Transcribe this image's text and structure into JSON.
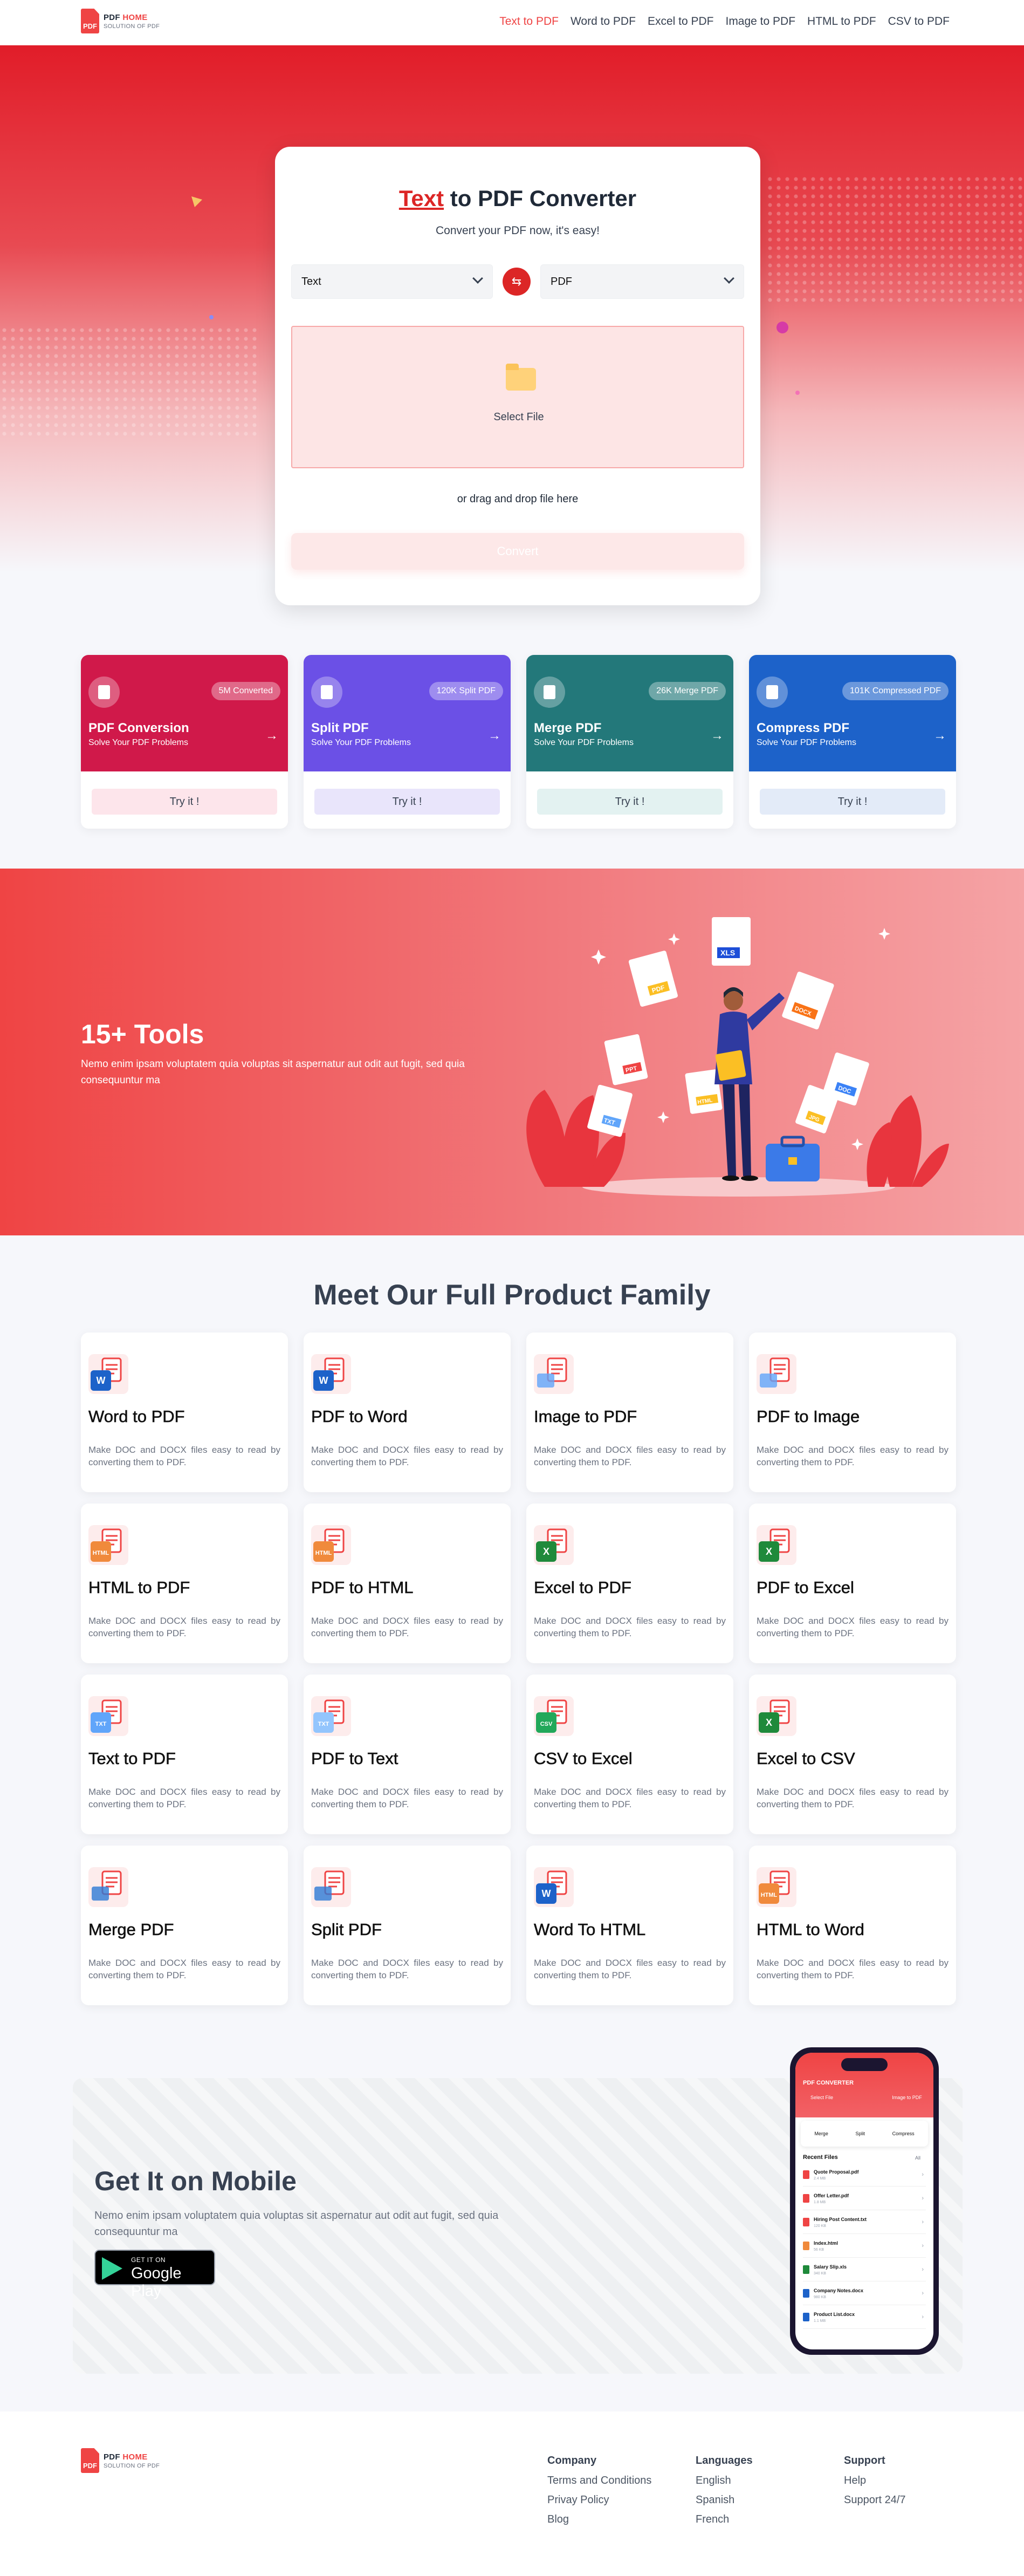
{
  "brand": {
    "name_part1": "PDF",
    "name_part2": "HOME",
    "tagline": "SOLUTION OF PDF",
    "mark": "PDF"
  },
  "nav": [
    {
      "label": "Text to PDF",
      "active": true
    },
    {
      "label": "Word to PDF"
    },
    {
      "label": "Excel to PDF"
    },
    {
      "label": "Image to PDF"
    },
    {
      "label": "HTML to PDF"
    },
    {
      "label": "CSV to PDF"
    }
  ],
  "converter": {
    "title_highlight": "Text",
    "title_rest": " to PDF Converter",
    "subtitle": "Convert your PDF now, it's easy!",
    "from_value": "Text",
    "to_value": "PDF",
    "drop_label": "Select File",
    "drag_text": "or drag and drop file here",
    "convert_label": "Convert"
  },
  "features": [
    {
      "title": "PDF Conversion",
      "subtitle": "Solve Your PDF Problems",
      "badge": "5M Converted",
      "try": "Try it !",
      "color": "#d0194a",
      "try_bg": "#fde5eb"
    },
    {
      "title": "Split PDF",
      "subtitle": "Solve Your PDF Problems",
      "badge": "120K Split PDF",
      "try": "Try it !",
      "color": "#6b50e6",
      "try_bg": "#e9e5fb"
    },
    {
      "title": "Merge PDF",
      "subtitle": "Solve Your PDF Problems",
      "badge": "26K Merge PDF",
      "try": "Try it !",
      "color": "#23787a",
      "try_bg": "#e3f2f1"
    },
    {
      "title": "Compress PDF",
      "subtitle": "Solve Your PDF Problems",
      "badge": "101K Compressed PDF",
      "try": "Try it !",
      "color": "#1d62c9",
      "try_bg": "#e3ebf8"
    }
  ],
  "tools": {
    "title": "15+ Tools",
    "description": "Nemo enim ipsam voluptatem quia voluptas sit aspernatur aut odit aut fugit, sed quia consequuntur ma",
    "doc_labels": [
      "XLS",
      "PDF",
      "DOCX",
      "PPT",
      "TXT",
      "DOC",
      "HTML",
      "JPG"
    ]
  },
  "family": {
    "title": "Meet Our Full Product Family",
    "products": [
      {
        "title": "Word to PDF",
        "desc": "Make DOC and DOCX files easy to read by converting them to PDF.",
        "icon": "word-to-pdf-icon",
        "tag": "W",
        "tag_color": "#1d62c9"
      },
      {
        "title": "PDF to Word",
        "desc": "Make DOC and DOCX files easy to read by converting them to PDF.",
        "icon": "pdf-to-word-icon",
        "tag": "W",
        "tag_color": "#1d62c9"
      },
      {
        "title": "Image to PDF",
        "desc": "Make DOC and DOCX files easy to read by converting them to PDF.",
        "icon": "image-to-pdf-icon",
        "tag": "",
        "tag_color": "#60a5fa"
      },
      {
        "title": "PDF to Image",
        "desc": "Make DOC and DOCX files easy to read by converting them to PDF.",
        "icon": "pdf-to-image-icon",
        "tag": "",
        "tag_color": "#60a5fa"
      },
      {
        "title": "HTML to PDF",
        "desc": "Make DOC and DOCX files easy to read by converting them to PDF.",
        "icon": "html-to-pdf-icon",
        "tag": "HTML",
        "tag_color": "#f08a3c"
      },
      {
        "title": "PDF to HTML",
        "desc": "Make DOC and DOCX files easy to read by converting them to PDF.",
        "icon": "pdf-to-html-icon",
        "tag": "HTML",
        "tag_color": "#f08a3c"
      },
      {
        "title": "Excel to PDF",
        "desc": "Make DOC and DOCX files easy to read by converting them to PDF.",
        "icon": "excel-to-pdf-icon",
        "tag": "X",
        "tag_color": "#1f8a3b"
      },
      {
        "title": "PDF to Excel",
        "desc": "Make DOC and DOCX files easy to read by converting them to PDF.",
        "icon": "pdf-to-excel-icon",
        "tag": "X",
        "tag_color": "#1f8a3b"
      },
      {
        "title": "Text to PDF",
        "desc": "Make DOC and DOCX files easy to read by converting them to PDF.",
        "icon": "text-to-pdf-icon",
        "tag": "TXT",
        "tag_color": "#60a5fa"
      },
      {
        "title": "PDF to Text",
        "desc": "Make DOC and DOCX files easy to read by converting them to PDF.",
        "icon": "pdf-to-text-icon",
        "tag": "TXT",
        "tag_color": "#93c5fd"
      },
      {
        "title": "CSV to Excel",
        "desc": "Make DOC and DOCX files easy to read by converting them to PDF.",
        "icon": "csv-to-excel-icon",
        "tag": "CSV",
        "tag_color": "#22a85a"
      },
      {
        "title": "Excel to CSV",
        "desc": "Make DOC and DOCX files easy to read by converting them to PDF.",
        "icon": "excel-to-csv-icon",
        "tag": "X",
        "tag_color": "#1f8a3b"
      },
      {
        "title": "Merge PDF",
        "desc": "Make DOC and DOCX files easy to read by converting them to PDF.",
        "icon": "merge-pdf-icon",
        "tag": "",
        "tag_color": "#2d7ad6"
      },
      {
        "title": "Split PDF",
        "desc": "Make DOC and DOCX files easy to read by converting them to PDF.",
        "icon": "split-pdf-icon",
        "tag": "",
        "tag_color": "#2d7ad6"
      },
      {
        "title": "Word To HTML",
        "desc": "Make DOC and DOCX files easy to read by converting them to PDF.",
        "icon": "word-to-html-icon",
        "tag": "W",
        "tag_color": "#1d62c9"
      },
      {
        "title": "HTML to Word",
        "desc": "Make DOC and DOCX files easy to read by converting them to PDF.",
        "icon": "html-to-word-icon",
        "tag": "HTML",
        "tag_color": "#f08a3c"
      }
    ]
  },
  "mobile": {
    "title": "Get It on Mobile",
    "description": "Nemo enim ipsam voluptatem quia voluptas sit aspernatur aut odit aut fugit, sed quia consequuntur ma",
    "store_small": "GET IT ON",
    "store_big": "Google Play",
    "phone": {
      "app_title": "PDF CONVERTER",
      "btn_select": "Select File",
      "btn_image": "Image to PDF",
      "quick": [
        "Merge",
        "Split",
        "Compress"
      ],
      "recent_label": "Recent Files",
      "recent_more": "All",
      "files": [
        {
          "name": "Quote Proposal.pdf",
          "meta": "2.4 MB",
          "color": "#ef4444"
        },
        {
          "name": "Offer Letter.pdf",
          "meta": "1.8 MB",
          "color": "#ef4444"
        },
        {
          "name": "Hiring Post Content.txt",
          "meta": "120 KB",
          "color": "#ef4444"
        },
        {
          "name": "Index.html",
          "meta": "56 KB",
          "color": "#f08a3c"
        },
        {
          "name": "Salary Slip.xls",
          "meta": "340 KB",
          "color": "#1f8a3b"
        },
        {
          "name": "Company Notes.docx",
          "meta": "980 KB",
          "color": "#1d62c9"
        },
        {
          "name": "Product List.docx",
          "meta": "1.1 MB",
          "color": "#1d62c9"
        }
      ]
    }
  },
  "footer": {
    "columns": [
      {
        "heading": "Company",
        "links": [
          "Terms and Conditions",
          "Privay Policy",
          "Blog"
        ]
      },
      {
        "heading": "Languages",
        "links": [
          "English",
          "Spanish",
          "French"
        ]
      },
      {
        "heading": "Support",
        "links": [
          "Help",
          "Support 24/7"
        ]
      }
    ]
  },
  "colors": {
    "accent": "#ef4444",
    "accent_dark": "#dc2626",
    "text_dark": "#374151"
  }
}
